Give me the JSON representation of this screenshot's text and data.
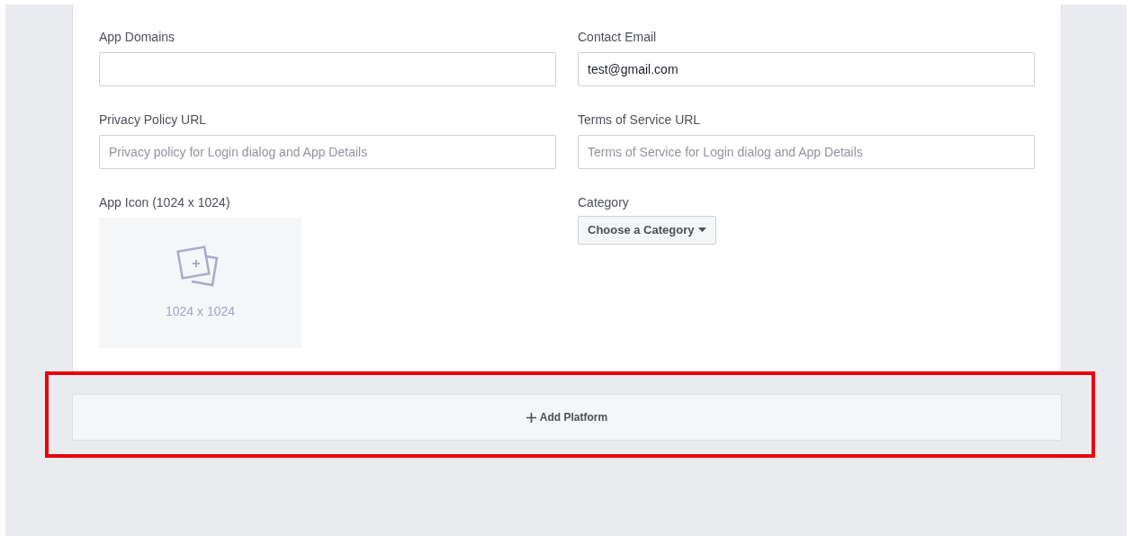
{
  "left_column": [
    {
      "kind": "field",
      "label": "App Domains"
    },
    {
      "kind": "field",
      "label": "Privacy Policy URL",
      "placeholder": "Privacy policy for Login dialog and App Details"
    },
    {
      "kind": "image",
      "label": "App Icon (1024 x 1024)",
      "caption": "1024 x 1024"
    }
  ],
  "right_column": [
    {
      "kind": "field",
      "label": "Contact Email",
      "value": "test@gmail.com"
    },
    {
      "kind": "field",
      "label": "Terms of Service URL",
      "placeholder": "Terms of Service for Login dialog and App Details"
    },
    {
      "kind": "dropdown",
      "label": "Category",
      "button": "Choose a Category"
    }
  ],
  "add_platform": {
    "label": "Add Platform",
    "highlighted": true
  }
}
